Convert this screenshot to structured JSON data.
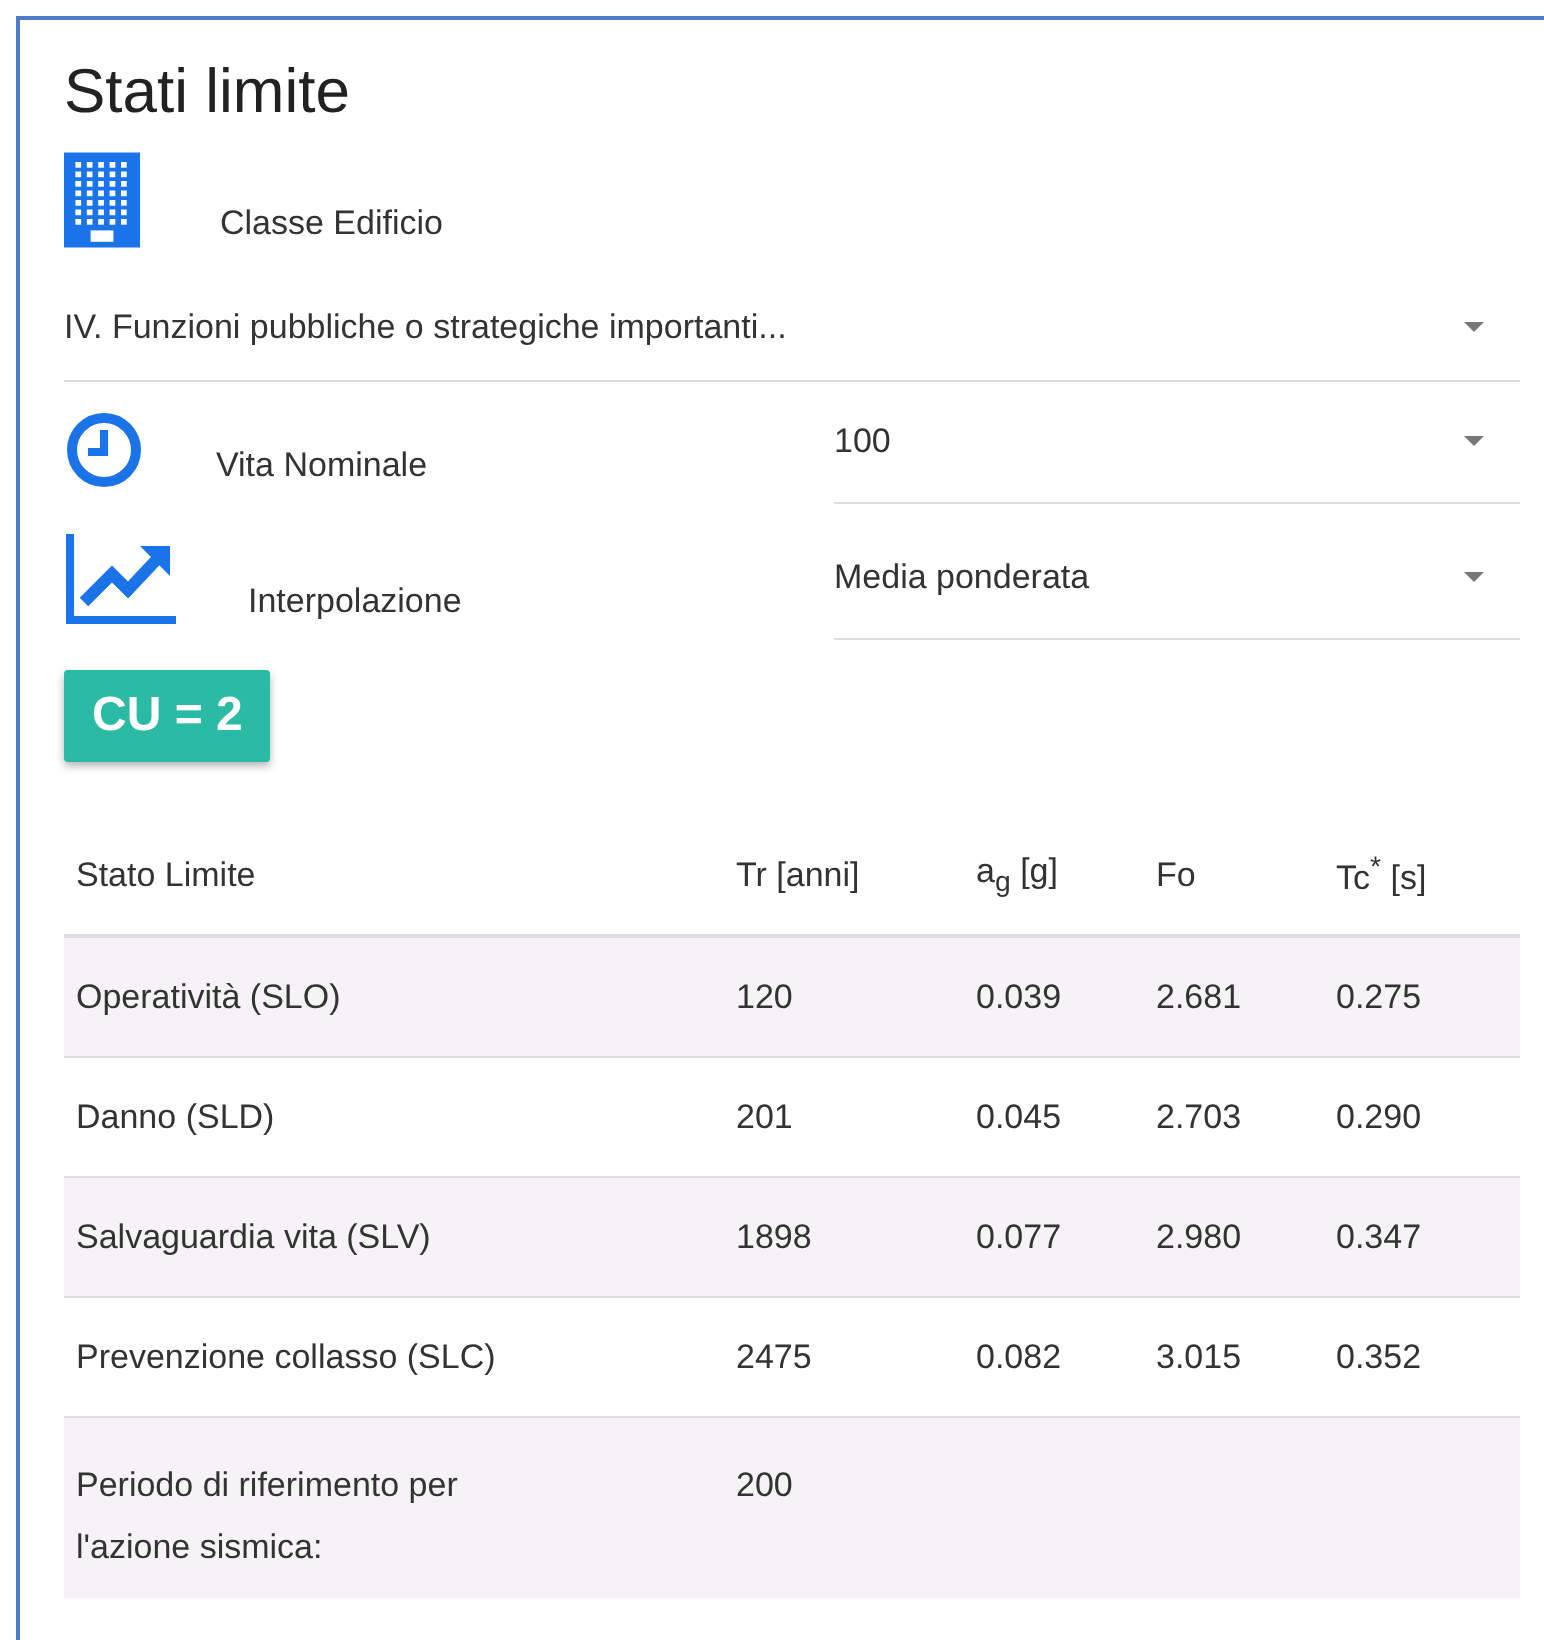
{
  "title": "Stati limite",
  "fields": [
    {
      "kind": "stacked",
      "label": "Classe Edificio",
      "value": "IV. Funzioni pubbliche o strategiche importanti..."
    },
    {
      "kind": "inline",
      "label": "Vita Nominale",
      "value": "100"
    },
    {
      "kind": "inline",
      "label": "Interpolazione",
      "value": "Media ponderata"
    }
  ],
  "badge": "CU = 2",
  "table": {
    "columns": [
      "Stato Limite",
      "Tr [anni]",
      "a$_{g}$ [g]",
      "Fo",
      "Tc$^{*}$ [s]"
    ],
    "rows": [
      [
        "Operatività (SLO)",
        "120",
        "0.039",
        "2.681",
        "0.275"
      ],
      [
        "Danno (SLD)",
        "201",
        "0.045",
        "2.703",
        "0.290"
      ],
      [
        "Salvaguardia vita (SLV)",
        "1898",
        "0.077",
        "2.980",
        "0.347"
      ],
      [
        "Prevenzione collasso (SLC)",
        "2475",
        "0.082",
        "3.015",
        "0.352"
      ],
      [
        "Periodo di riferimento per l'azione sismica:",
        "200"
      ]
    ]
  }
}
